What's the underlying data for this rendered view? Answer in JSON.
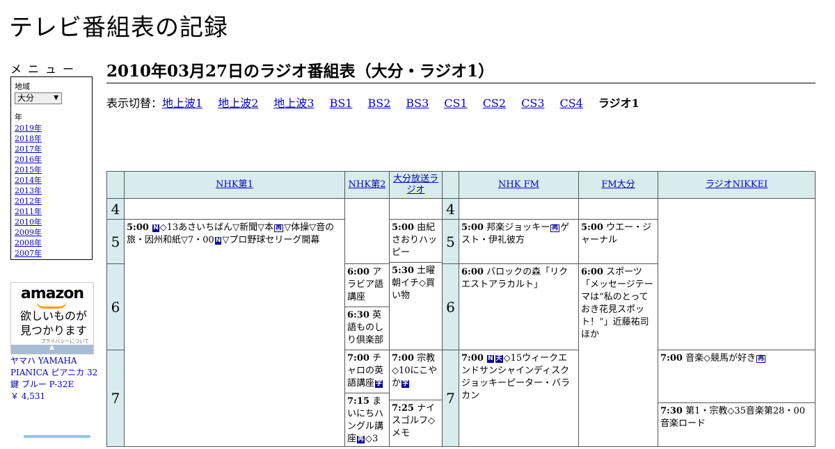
{
  "site": {
    "title": "テレビ番組表の記録"
  },
  "menu": {
    "heading": "メニュー",
    "region_label": "地域",
    "region_value": "大分",
    "year_label": "年",
    "years": [
      "2019年",
      "2018年",
      "2017年",
      "2016年",
      "2015年",
      "2014年",
      "2013年",
      "2012年",
      "2011年",
      "2010年",
      "2009年",
      "2008年",
      "2007年"
    ]
  },
  "ad": {
    "logo": "amazon",
    "tagline_1": "欲しいものが",
    "tagline_2": "見つかります",
    "privacy": "プライバシーについて",
    "product": "ヤマハ YAMAHA PIANICA ピアニカ 32鍵 ブルー P-32E",
    "price": "￥ 4,531"
  },
  "page": {
    "title": "2010年03月27日のラジオ番組表（大分・ラジオ1）"
  },
  "switcher": {
    "label": "表示切替：",
    "links": [
      "地上波1",
      "地上波2",
      "地上波3",
      "BS1",
      "BS2",
      "BS3",
      "CS1",
      "CS2",
      "CS3",
      "CS4"
    ],
    "current": "ラジオ1"
  },
  "grid": {
    "stations": [
      "NHK第1",
      "NHK第2",
      "大分放送ラジオ",
      "NHK FM",
      "FM大分",
      "ラジオNIKKEI"
    ],
    "hours": [
      "4",
      "5",
      "6",
      "7"
    ],
    "icons": {
      "news": "N",
      "rerun": "再",
      "bilingual": "二",
      "sub": "字",
      "weather": "天"
    },
    "programs": {
      "nhk1_500_time": "5:00",
      "nhk1_500_a": "◇13あさいちばん▽新聞▽本",
      "nhk1_500_b": "▽体操▽音の旅・因州和紙▽7・00",
      "nhk1_500_c": "▽プロ野球セリーグ開幕",
      "nhk2_600_time": "6:00",
      "nhk2_600_title": "アラビア語講座",
      "nhk2_630_time": "6:30",
      "nhk2_630_title": "英語ものしり倶楽部",
      "nhk2_700_time": "7:00",
      "nhk2_700_title": "チャロの英語講座",
      "nhk2_715_time": "7:15",
      "nhk2_715_title": "まいにちハングル講座",
      "nhk2_715_tail": "◇3",
      "obs_500_time": "5:00",
      "obs_500_title": "由紀さおりハッピー",
      "obs_530_time": "5:30",
      "obs_530_title": "土曜朝イチ◇買い物",
      "obs_700_time": "7:00",
      "obs_700_title": "宗教◇10にこやか",
      "obs_725_time": "7:25",
      "obs_725_title": "ナイスゴルフ◇メモ",
      "fm_500_time": "5:00",
      "fm_500_a": "邦楽ジョッキー",
      "fm_500_b": "ゲスト・伊礼彼方",
      "fm_600_time": "6:00",
      "fm_600_title": "バロックの森「リクエストアラカルト」",
      "fm_700_time": "7:00",
      "fm_700_title": "◇15ウィークエンドサンシャインディスクジョッキーピーター・バラカン",
      "fmo_500_time": "5:00",
      "fmo_500_title": "ウエー・ジャーナル",
      "fmo_600_time": "6:00",
      "fmo_600_title": "スポーツ「メッセージテーマは“私のとっておき花見スポット！”」近藤祐司ほか",
      "nik_700_time": "7:00",
      "nik_700_title": "音楽◇競馬が好き",
      "nik_730_time": "7:30",
      "nik_730_title": "第1・宗教◇35音楽第28・00音楽ロード"
    }
  }
}
